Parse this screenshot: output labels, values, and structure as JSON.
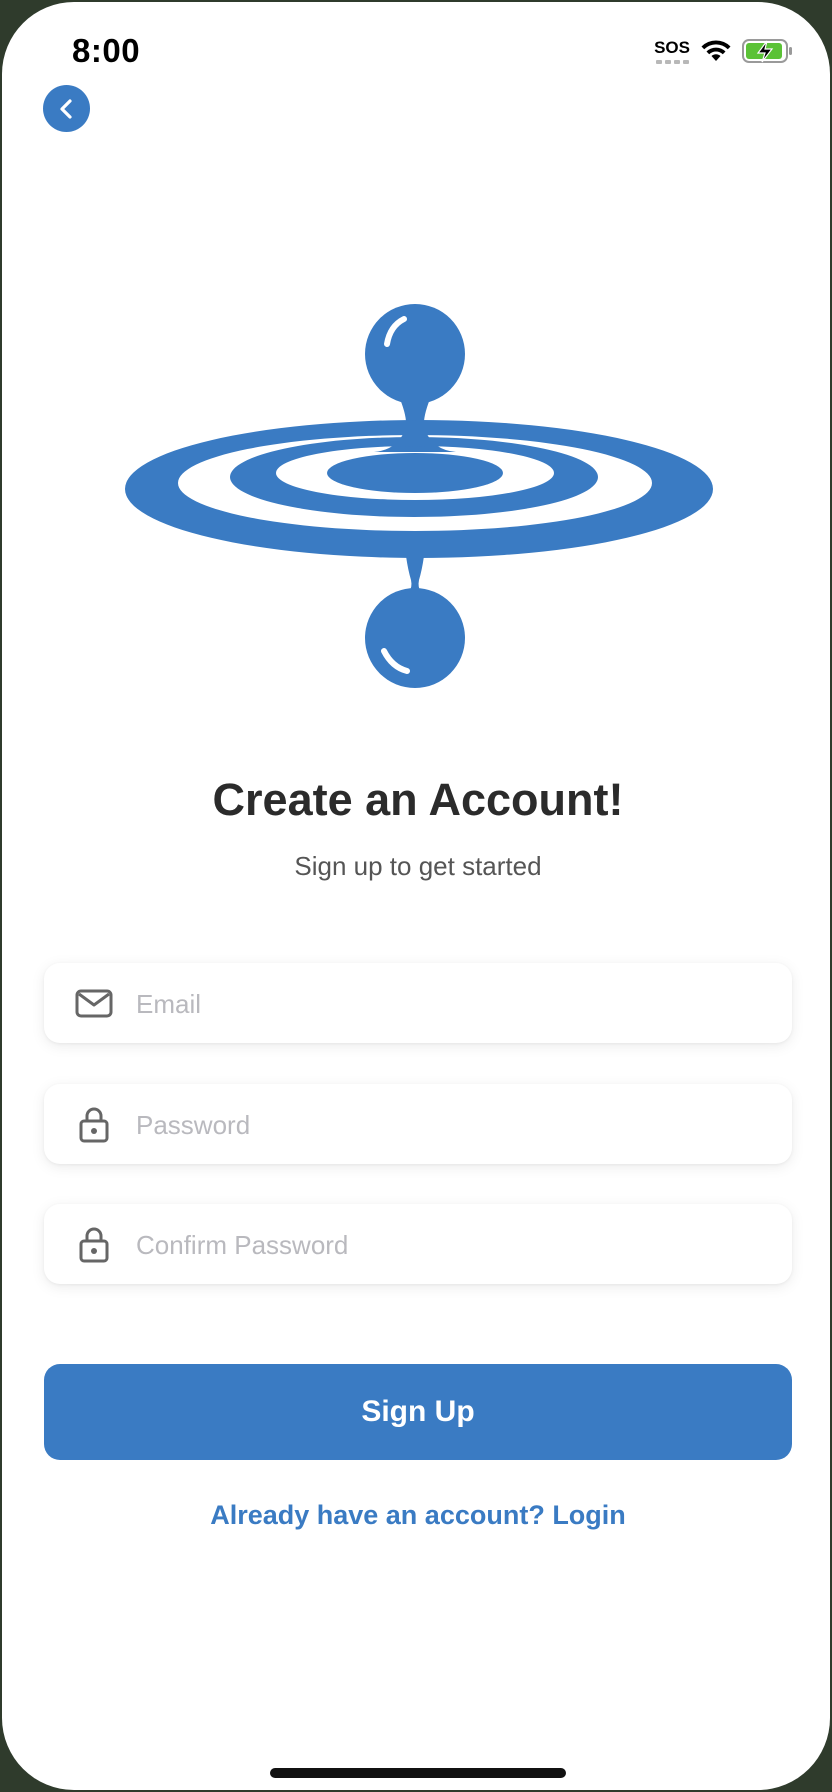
{
  "status_bar": {
    "time": "8:00",
    "sos": "SOS"
  },
  "header": {
    "back_icon": "chevron-left-icon"
  },
  "logo": {
    "icon": "water-drop-ripple-logo",
    "color": "#3a7bc3"
  },
  "title": "Create an Account!",
  "subtitle": "Sign up to get started",
  "form": {
    "email": {
      "placeholder": "Email",
      "value": "",
      "icon": "envelope-icon"
    },
    "password": {
      "placeholder": "Password",
      "value": "",
      "icon": "lock-icon"
    },
    "confirm_password": {
      "placeholder": "Confirm Password",
      "value": "",
      "icon": "lock-icon"
    }
  },
  "signup_button": "Sign Up",
  "login_link": "Already have an account? Login",
  "colors": {
    "accent": "#3a7bc3",
    "title_text": "#2b2b2b",
    "subtitle_text": "#555555",
    "placeholder_text": "#b9b9be"
  }
}
